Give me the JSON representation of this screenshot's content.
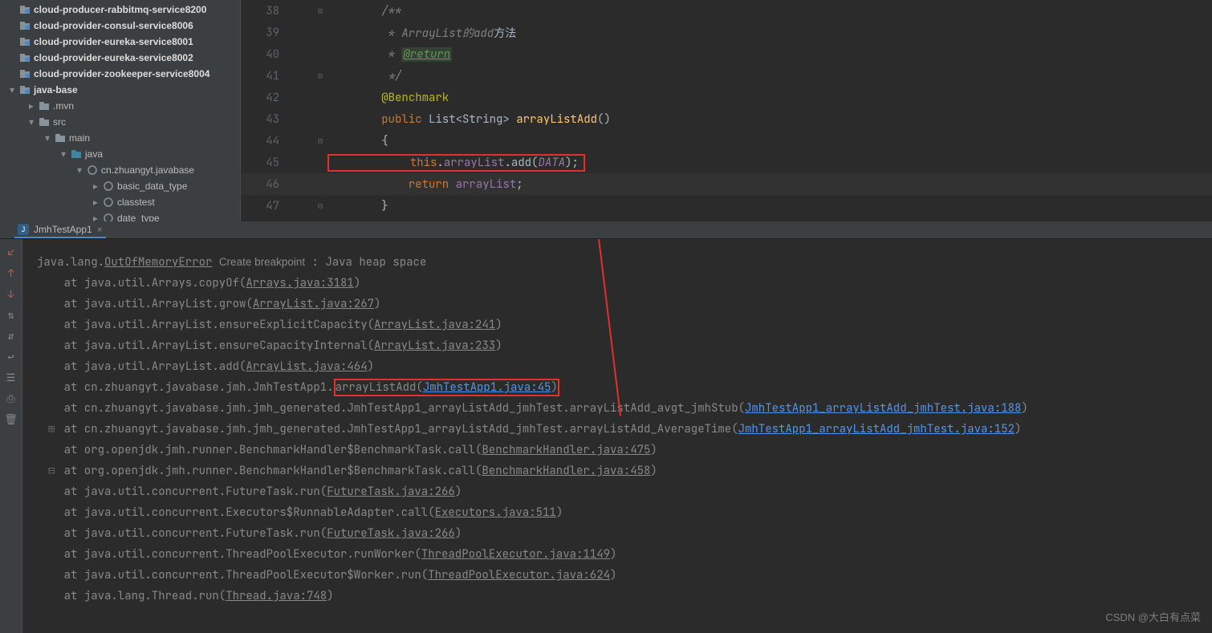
{
  "sidebar": {
    "items": [
      {
        "label": "cloud-producer-rabbitmq-service8200",
        "indent": 10,
        "bold": true,
        "chev": "",
        "icon": "folder"
      },
      {
        "label": "cloud-provider-consul-service8006",
        "indent": 10,
        "bold": true,
        "chev": "",
        "icon": "folder"
      },
      {
        "label": "cloud-provider-eureka-service8001",
        "indent": 10,
        "bold": true,
        "chev": "",
        "icon": "folder"
      },
      {
        "label": "cloud-provider-eureka-service8002",
        "indent": 10,
        "bold": true,
        "chev": "",
        "icon": "folder"
      },
      {
        "label": "cloud-provider-zookeeper-service8004",
        "indent": 10,
        "bold": true,
        "chev": "",
        "icon": "folder"
      },
      {
        "label": "java-base",
        "indent": 10,
        "bold": true,
        "chev": "▾",
        "icon": "folder"
      },
      {
        "label": ".mvn",
        "indent": 34,
        "bold": false,
        "chev": "▸",
        "icon": "dir"
      },
      {
        "label": "src",
        "indent": 34,
        "bold": false,
        "chev": "▾",
        "icon": "dir"
      },
      {
        "label": "main",
        "indent": 54,
        "bold": false,
        "chev": "▾",
        "icon": "dir"
      },
      {
        "label": "java",
        "indent": 74,
        "bold": false,
        "chev": "▾",
        "icon": "src"
      },
      {
        "label": "cn.zhuangyt.javabase",
        "indent": 94,
        "bold": false,
        "chev": "▾",
        "icon": "pkg"
      },
      {
        "label": "basic_data_type",
        "indent": 114,
        "bold": false,
        "chev": "▸",
        "icon": "pkg"
      },
      {
        "label": "classtest",
        "indent": 114,
        "bold": false,
        "chev": "▸",
        "icon": "pkg"
      },
      {
        "label": "date_type",
        "indent": 114,
        "bold": false,
        "chev": "▸",
        "icon": "pkg"
      }
    ]
  },
  "editor": {
    "lines": [
      {
        "n": 38,
        "fold": "⊟",
        "html": "        <span class='c-comment'>/**</span>"
      },
      {
        "n": 39,
        "fold": "",
        "html": "        <span class='c-comment'> * ArrayList的add</span><span class='c-plain'>方法</span>"
      },
      {
        "n": 40,
        "fold": "",
        "html": "        <span class='c-comment'> * </span><span class='tag-return'>@return</span>"
      },
      {
        "n": 41,
        "fold": "⊟",
        "html": "        <span class='c-comment'> */</span>"
      },
      {
        "n": 42,
        "fold": "",
        "html": "        <span class='c-ann'>@Benchmark</span>"
      },
      {
        "n": 43,
        "fold": "",
        "html": "        <span class='c-key'>public </span><span class='c-type'>List&lt;String&gt; </span><span class='c-method'>arrayListAdd</span><span class='c-plain'>()</span>"
      },
      {
        "n": 44,
        "fold": "⊟",
        "html": "        <span class='c-plain'>{</span>"
      },
      {
        "n": 45,
        "fold": "",
        "html": "            <span class='c-key'>this</span><span class='c-plain'>.</span><span class='c-field'>arrayList</span><span class='c-plain'>.add(</span><span class='c-static'>DATA</span><span class='c-plain'>);</span>",
        "boxed": true
      },
      {
        "n": 46,
        "fold": "",
        "html": "            <span class='c-key'>return </span><span class='c-field'>arrayList</span><span class='c-plain'>;</span>",
        "hl": true
      },
      {
        "n": 47,
        "fold": "⊟",
        "html": "        <span class='c-plain'>}</span>"
      }
    ]
  },
  "console": {
    "tab_icon": "J",
    "tab_name": "JmhTestApp1",
    "error_head_pre": "java.lang.",
    "error_head_link": "OutOfMemoryError",
    "create_bp": "Create breakpoint",
    "error_head_post": " : Java heap space",
    "stack": [
      {
        "pre": "    at java.util.Arrays.copyOf(",
        "link": "Arrays.java:3181",
        "post": ")"
      },
      {
        "pre": "    at java.util.ArrayList.grow(",
        "link": "ArrayList.java:267",
        "post": ")"
      },
      {
        "pre": "    at java.util.ArrayList.ensureExplicitCapacity(",
        "link": "ArrayList.java:241",
        "post": ")"
      },
      {
        "pre": "    at java.util.ArrayList.ensureCapacityInternal(",
        "link": "ArrayList.java:233",
        "post": ")"
      },
      {
        "pre": "    at java.util.ArrayList.add(",
        "link": "ArrayList.java:464",
        "post": ")"
      },
      {
        "pre": "    at cn.zhuangyt.javabase.jmh.JmhTestApp1.",
        "box_pre": "arrayListAdd(",
        "box_link": "JmhTestApp1.java:45",
        "box_post": ")",
        "blue": true
      },
      {
        "pre": "    at cn.zhuangyt.javabase.jmh.jmh_generated.JmhTestApp1_arrayListAdd_jmhTest.arrayListAdd_avgt_jmhStub(",
        "link": "JmhTestApp1_arrayListAdd_jmhTest.java:188",
        "post": ")",
        "blue": true
      },
      {
        "pre": "    at cn.zhuangyt.javabase.jmh.jmh_generated.JmhTestApp1_arrayListAdd_jmhTest.arrayListAdd_AverageTime(",
        "link": "JmhTestApp1_arrayListAdd_jmhTest.java:152",
        "post": ")",
        "blue": true
      },
      {
        "pre": "    at org.openjdk.jmh.runner.BenchmarkHandler$BenchmarkTask.call(",
        "link": "BenchmarkHandler.java:475",
        "post": ")"
      },
      {
        "pre": "    at org.openjdk.jmh.runner.BenchmarkHandler$BenchmarkTask.call(",
        "link": "BenchmarkHandler.java:458",
        "post": ")"
      },
      {
        "pre": "    at java.util.concurrent.FutureTask.run(",
        "link": "FutureTask.java:266",
        "post": ")"
      },
      {
        "pre": "    at java.util.concurrent.Executors$RunnableAdapter.call(",
        "link": "Executors.java:511",
        "post": ")"
      },
      {
        "pre": "    at java.util.concurrent.FutureTask.run(",
        "link": "FutureTask.java:266",
        "post": ")"
      },
      {
        "pre": "    at java.util.concurrent.ThreadPoolExecutor.runWorker(",
        "link": "ThreadPoolExecutor.java:1149",
        "post": ")"
      },
      {
        "pre": "    at java.util.concurrent.ThreadPoolExecutor$Worker.run(",
        "link": "ThreadPoolExecutor.java:624",
        "post": ")"
      },
      {
        "pre": "    at java.lang.Thread.run(",
        "link": "Thread.java:748",
        "post": ")"
      }
    ]
  },
  "toolbar_icons": [
    "arrow-red-left",
    "arrow-red-up",
    "arrow-red-down",
    "sort-asc",
    "sort-desc",
    "wrap",
    "scroll",
    "print",
    "trash"
  ],
  "watermark": "CSDN @大白有点菜"
}
